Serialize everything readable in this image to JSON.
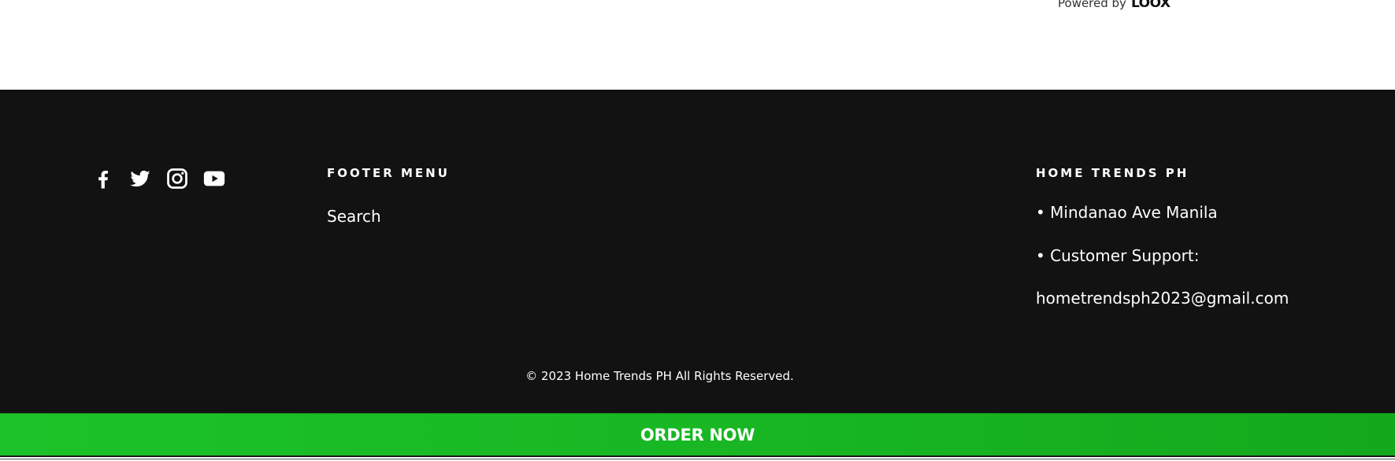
{
  "powered": {
    "prefix": "Powered by",
    "brand": "LOOX"
  },
  "social": [
    {
      "name": "facebook",
      "icon": "facebook-icon"
    },
    {
      "name": "twitter",
      "icon": "twitter-icon"
    },
    {
      "name": "instagram",
      "icon": "instagram-icon"
    },
    {
      "name": "youtube",
      "icon": "youtube-icon"
    }
  ],
  "footer_menu": {
    "heading": "FOOTER MENU",
    "links": [
      "Search"
    ]
  },
  "store_info": {
    "heading": "HOME TRENDS PH",
    "address": "• Mindanao Ave Manila",
    "support_label": "• Customer Support:",
    "email": "hometrendsph2023@gmail.com"
  },
  "copyright": "© 2023 Home Trends PH All Rights Reserved.",
  "order_bar": {
    "label": "ORDER NOW",
    "color": "#1cc229"
  },
  "colors": {
    "footer_bg": "#121212",
    "text": "#ffffff"
  }
}
